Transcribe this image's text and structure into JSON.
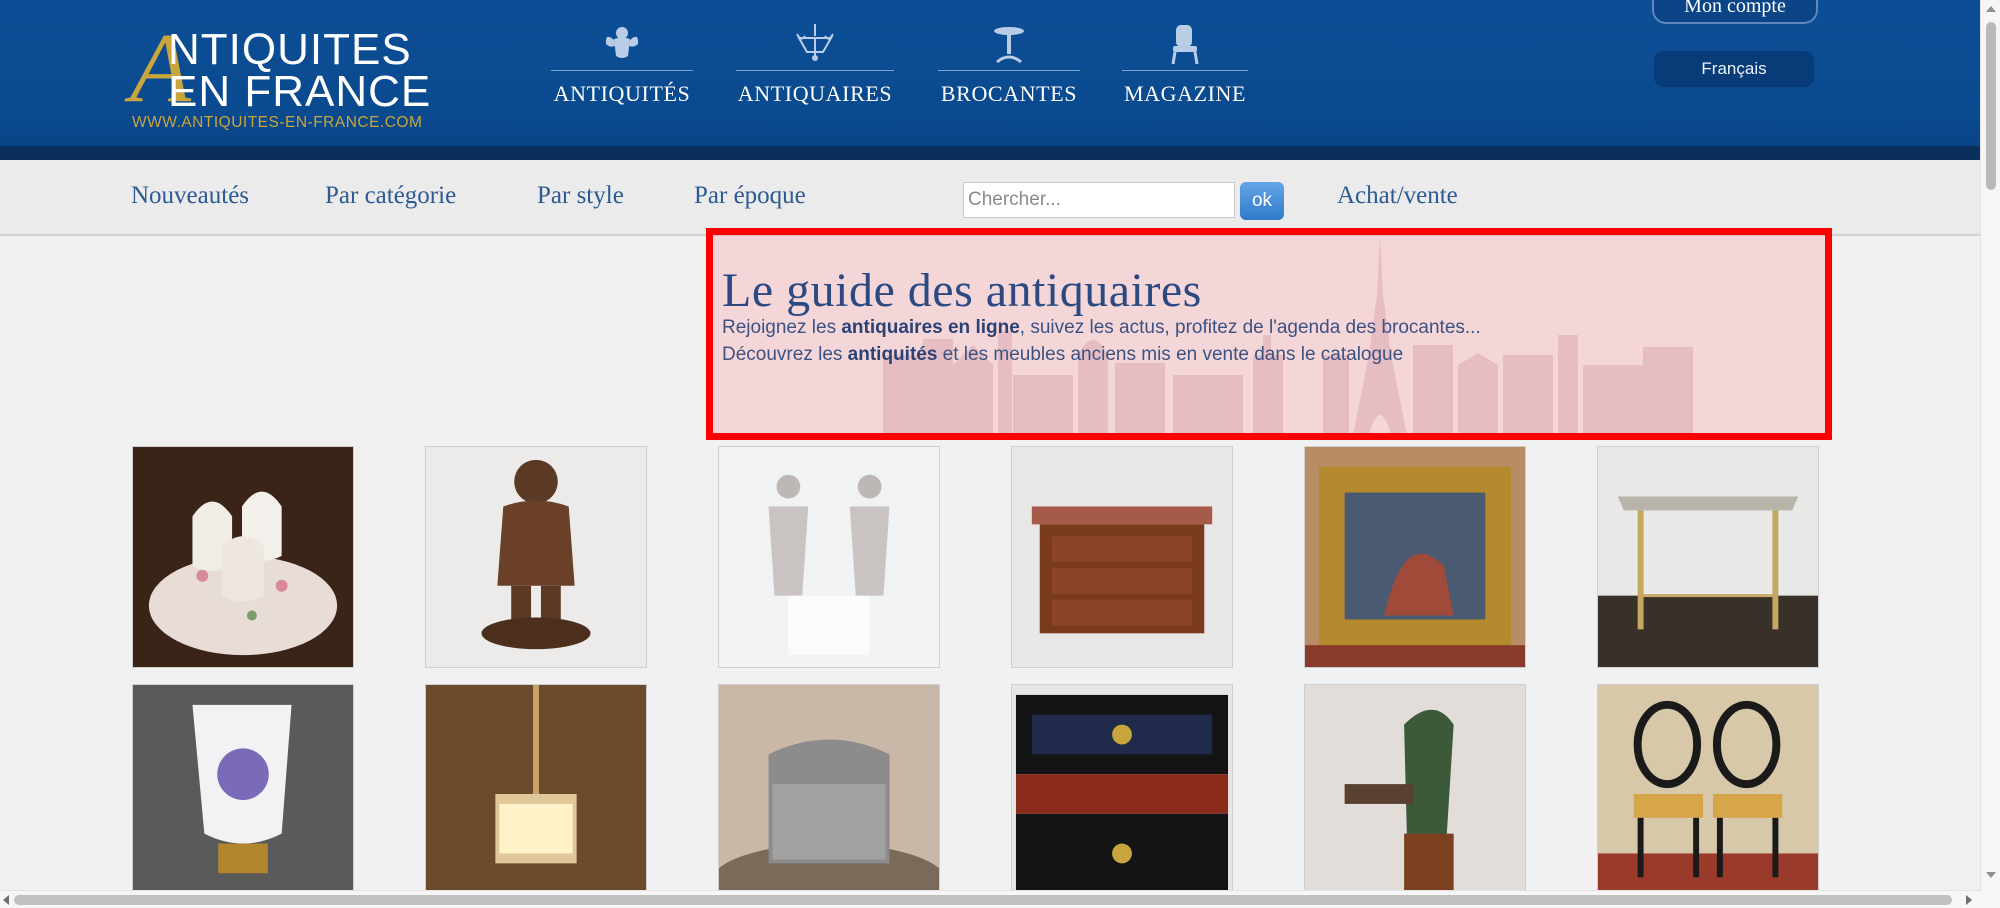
{
  "header": {
    "logo": {
      "big_letter": "A",
      "line1": "NTIQUITES",
      "line2": "EN FRANCE",
      "url": "WWW.ANTIQUITES-EN-FRANCE.COM"
    },
    "nav": [
      {
        "label": "ANTIQUITÉS",
        "icon": "cherub-icon"
      },
      {
        "label": "ANTIQUAIRES",
        "icon": "chandelier-icon"
      },
      {
        "label": "BROCANTES",
        "icon": "pedestal-table-icon"
      },
      {
        "label": "MAGAZINE",
        "icon": "armchair-icon"
      }
    ],
    "account_label": "Mon compte",
    "language": "Français"
  },
  "subnav": {
    "items": [
      "Nouveautés",
      "Par catégorie",
      "Par style",
      "Par époque"
    ],
    "search_placeholder": "Chercher...",
    "search_button": "ok",
    "extra": "Achat/vente"
  },
  "guide": {
    "title": "Le guide des antiquaires",
    "line1_pre": "Rejoignez les ",
    "line1_bold": "antiquaires en ligne",
    "line1_post": ", suivez les actus, profitez de l'agenda des brocantes...",
    "line2_pre": "Découvrez les ",
    "line2_bold": "antiquités",
    "line2_post": " et les meubles anciens mis en vente dans le catalogue"
  },
  "products": [
    {
      "name": "porcelain-egg-cups-image"
    },
    {
      "name": "bronze-boy-statue-image"
    },
    {
      "name": "chandelier-earrings-image"
    },
    {
      "name": "marble-top-commode-image"
    },
    {
      "name": "framed-painting-image"
    },
    {
      "name": "console-table-image"
    },
    {
      "name": "painted-pitcher-image"
    },
    {
      "name": "glass-pendant-lamp-image"
    },
    {
      "name": "pewter-box-image"
    },
    {
      "name": "boulle-cabinet-image"
    },
    {
      "name": "cast-iron-pump-image"
    },
    {
      "name": "pair-of-chairs-image"
    }
  ],
  "colors": {
    "header_blue": "#0c4e96",
    "logo_gold": "#c9a53e",
    "link_blue": "#2c5a94",
    "highlight_red": "#ff0000"
  }
}
